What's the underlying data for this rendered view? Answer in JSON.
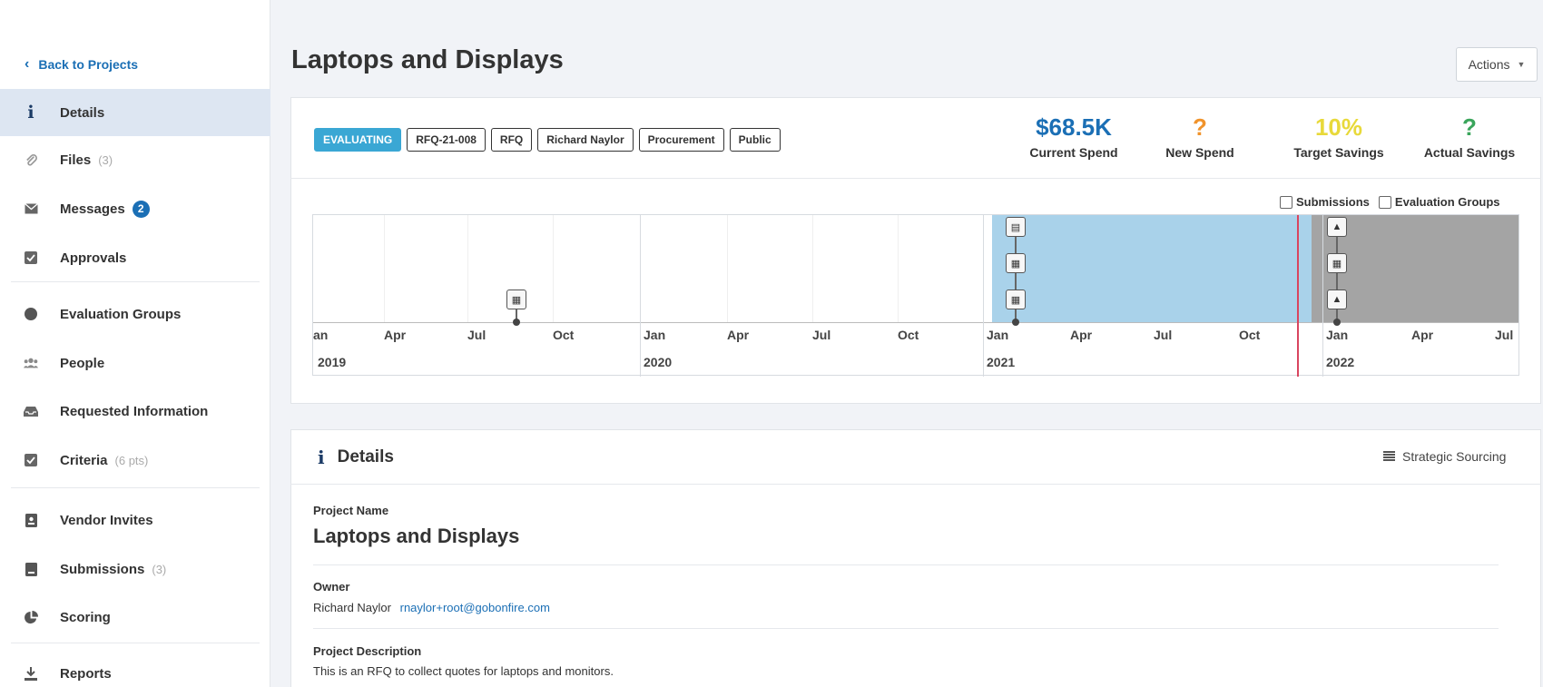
{
  "sidebar": {
    "back_label": "Back to Projects",
    "items": [
      {
        "label": "Details",
        "icon": "info-icon"
      },
      {
        "label": "Files",
        "count": "(3)",
        "icon": "paperclip-icon"
      },
      {
        "label": "Messages",
        "badge": "2",
        "icon": "envelope-icon"
      },
      {
        "label": "Approvals",
        "icon": "checkbox-icon"
      },
      {
        "label": "Evaluation Groups",
        "icon": "circle-icon"
      },
      {
        "label": "People",
        "icon": "users-icon"
      },
      {
        "label": "Requested Information",
        "icon": "inbox-icon"
      },
      {
        "label": "Criteria",
        "count": "(6 pts)",
        "icon": "checkbox-icon"
      },
      {
        "label": "Vendor Invites",
        "icon": "contact-card-icon"
      },
      {
        "label": "Submissions",
        "count": "(3)",
        "icon": "document-icon"
      },
      {
        "label": "Scoring",
        "icon": "pie-chart-icon"
      },
      {
        "label": "Reports",
        "icon": "download-icon"
      }
    ]
  },
  "header": {
    "title": "Laptops and Displays",
    "actions_label": "Actions"
  },
  "tags": {
    "status": "EVALUATING",
    "items": [
      "RFQ-21-008",
      "RFQ",
      "Richard Naylor",
      "Procurement",
      "Public"
    ]
  },
  "metrics": [
    {
      "value": "$68.5K",
      "label": "Current Spend",
      "color": "#1b6fb5"
    },
    {
      "value": "?",
      "label": "New Spend",
      "color": "#f0932b"
    },
    {
      "value": "10%",
      "label": "Target Savings",
      "color": "#e8d93a"
    },
    {
      "value": "?",
      "label": "Actual Savings",
      "color": "#3aa55b"
    }
  ],
  "timeline": {
    "checkboxes": [
      "Submissions",
      "Evaluation Groups"
    ],
    "months": [
      "an",
      "Apr",
      "Jul",
      "Oct",
      "Jan",
      "Apr",
      "Jul",
      "Oct",
      "Jan",
      "Apr",
      "Jul",
      "Oct",
      "Jan",
      "Apr",
      "Jul"
    ],
    "years": [
      "2019",
      "2020",
      "2021",
      "2022"
    ]
  },
  "details": {
    "heading": "Details",
    "category": "Strategic Sourcing",
    "project_name_label": "Project Name",
    "project_name": "Laptops and Displays",
    "owner_label": "Owner",
    "owner_name": "Richard Naylor",
    "owner_email": "rnaylor+root@gobonfire.com",
    "description_label": "Project Description",
    "description": "This is an RFQ to collect quotes for laptops and monitors."
  },
  "colors": {
    "accent": "#1b6fb5",
    "status_tag": "#3aa7d4",
    "timeline_active": "#a9d2ea",
    "timeline_future": "#a4a4a4",
    "today_line": "#d9455f"
  }
}
